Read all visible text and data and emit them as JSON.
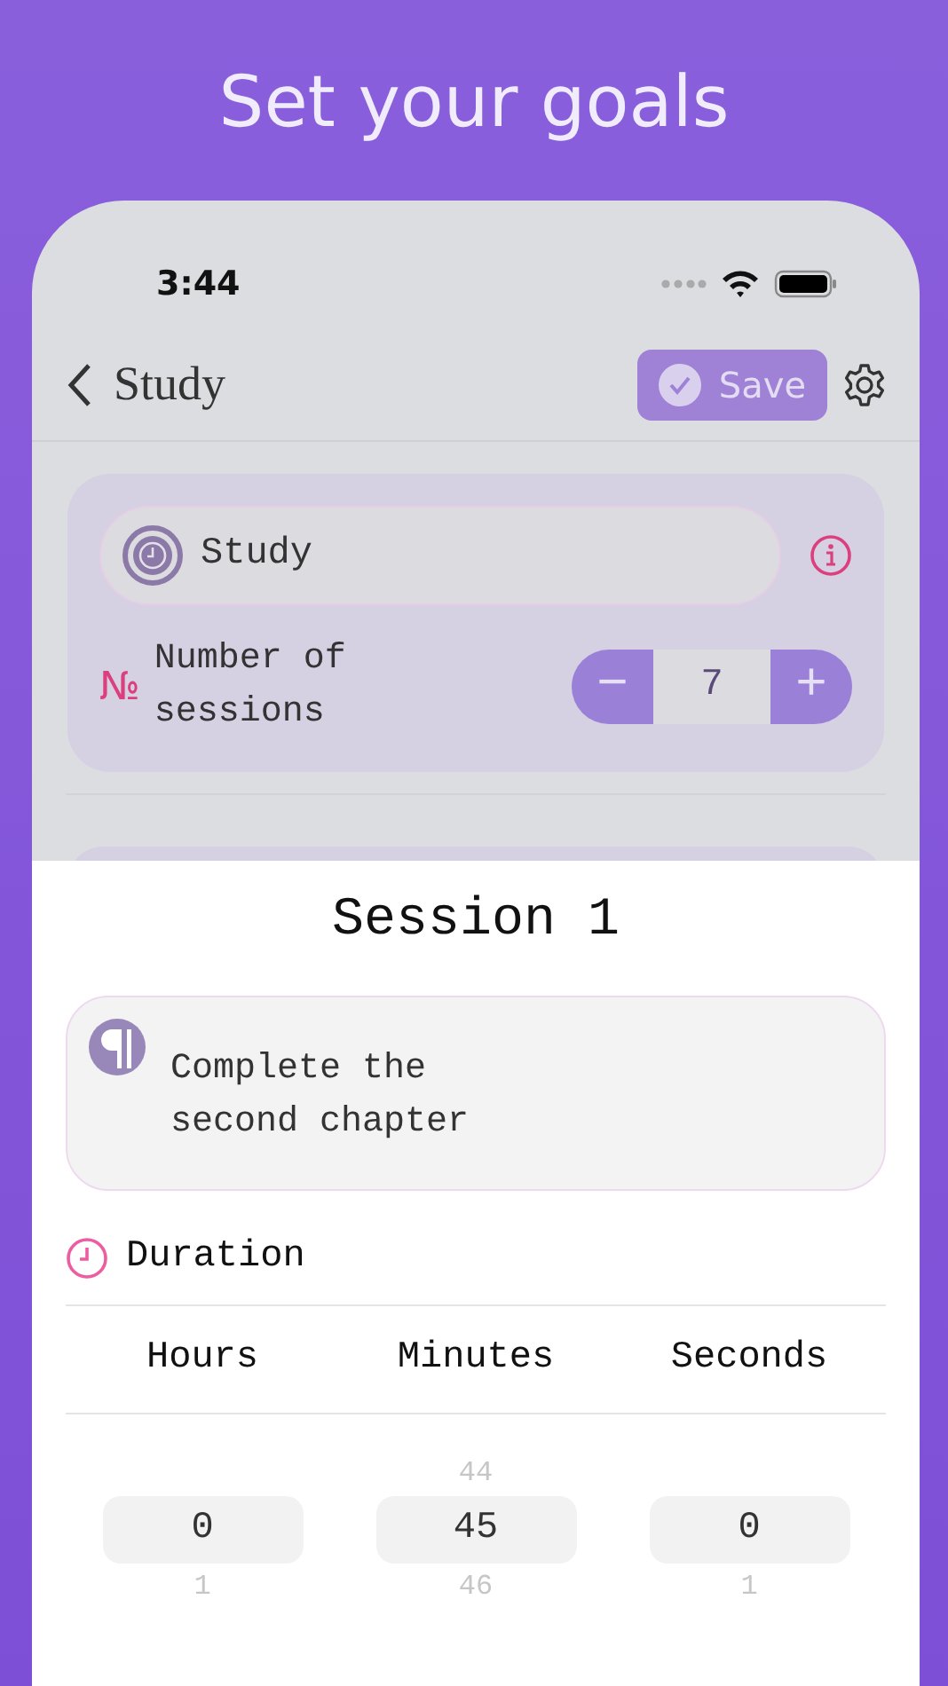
{
  "headline": "Set your goals",
  "status_bar": {
    "time": "3:44"
  },
  "nav": {
    "back_title": "Study",
    "save_label": "Save"
  },
  "goal_card": {
    "name": "Study",
    "sessions_symbol": "№",
    "sessions_label": "Number of sessions",
    "decrement": "−",
    "count": "7",
    "increment": "+"
  },
  "sheet": {
    "title": "Session 1",
    "note": "Complete the second chapter",
    "duration_label": "Duration",
    "pickers": [
      {
        "label": "Hours",
        "options": [
          {
            "value": "0",
            "selected": true
          },
          {
            "value": "1",
            "selected": false
          }
        ]
      },
      {
        "label": "Minutes",
        "options": [
          {
            "value": "44",
            "selected": false
          },
          {
            "value": "45",
            "selected": true
          },
          {
            "value": "46",
            "selected": false
          }
        ]
      },
      {
        "label": "Seconds",
        "options": [
          {
            "value": "0",
            "selected": true
          },
          {
            "value": "1",
            "selected": false
          }
        ]
      }
    ]
  }
}
